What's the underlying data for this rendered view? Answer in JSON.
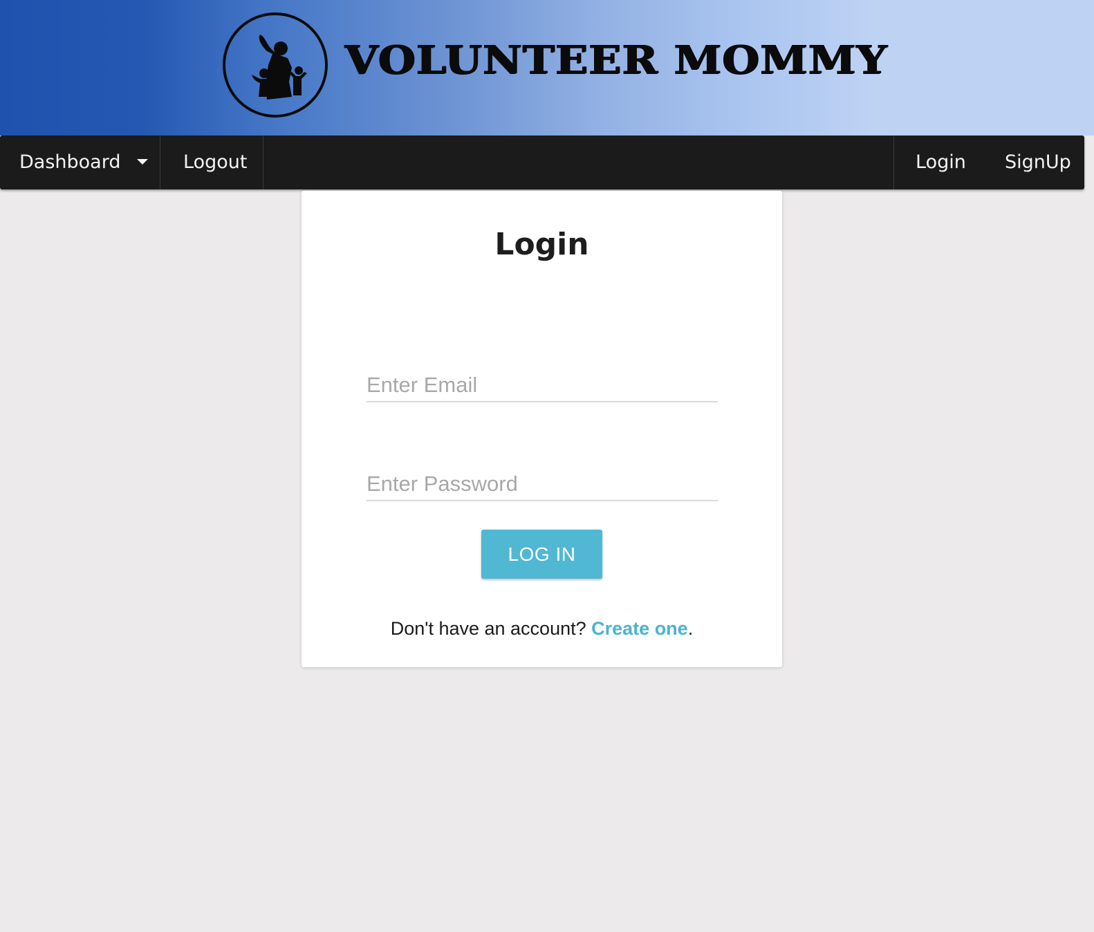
{
  "header": {
    "logo_text": "VOLUNTEER MOMMY",
    "logo_icon": "family-icon"
  },
  "nav": {
    "dashboard_label": "Dashboard",
    "logout_label": "Logout",
    "login_label": "Login",
    "signup_label": "SignUp"
  },
  "login_form": {
    "title": "Login",
    "email_placeholder": "Enter Email",
    "password_placeholder": "Enter Password",
    "submit_label": "LOG IN",
    "no_account_text": "Don't have an account?",
    "create_link_label": "Create one",
    "trailing_period": "."
  },
  "colors": {
    "header_gradient_start": "#1f52ae",
    "header_gradient_end": "#bed2f4",
    "navbar_bg": "#1b1b1b",
    "page_bg": "#edeaeb",
    "accent": "#50b8d3"
  }
}
